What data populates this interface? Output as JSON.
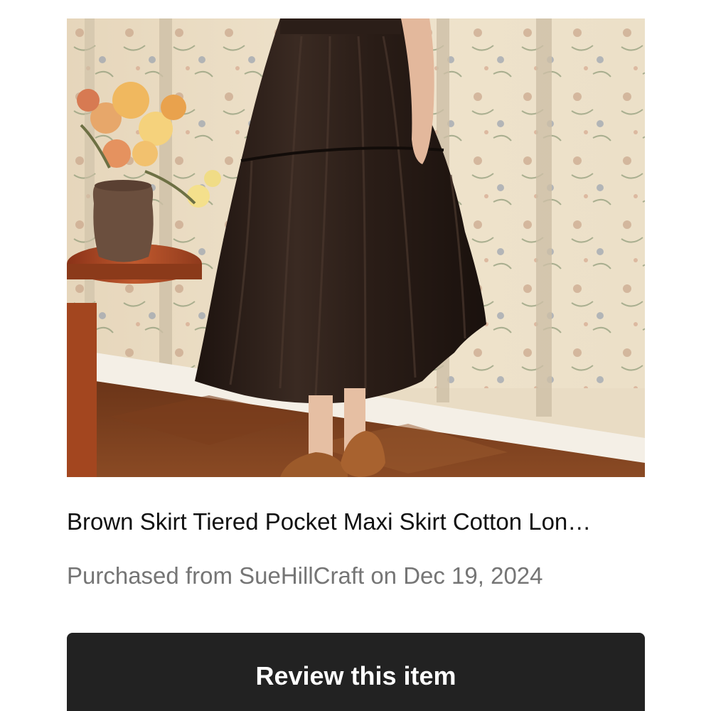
{
  "item": {
    "title": "Brown Skirt Tiered Pocket Maxi Skirt Cotton Lon…",
    "purchase_info": "Purchased from SueHillCraft on Dec 19, 2024"
  },
  "actions": {
    "review_label": "Review this item"
  },
  "colors": {
    "button_background": "#222222",
    "button_text": "#ffffff",
    "title_text": "#111111",
    "secondary_text": "#757575"
  }
}
